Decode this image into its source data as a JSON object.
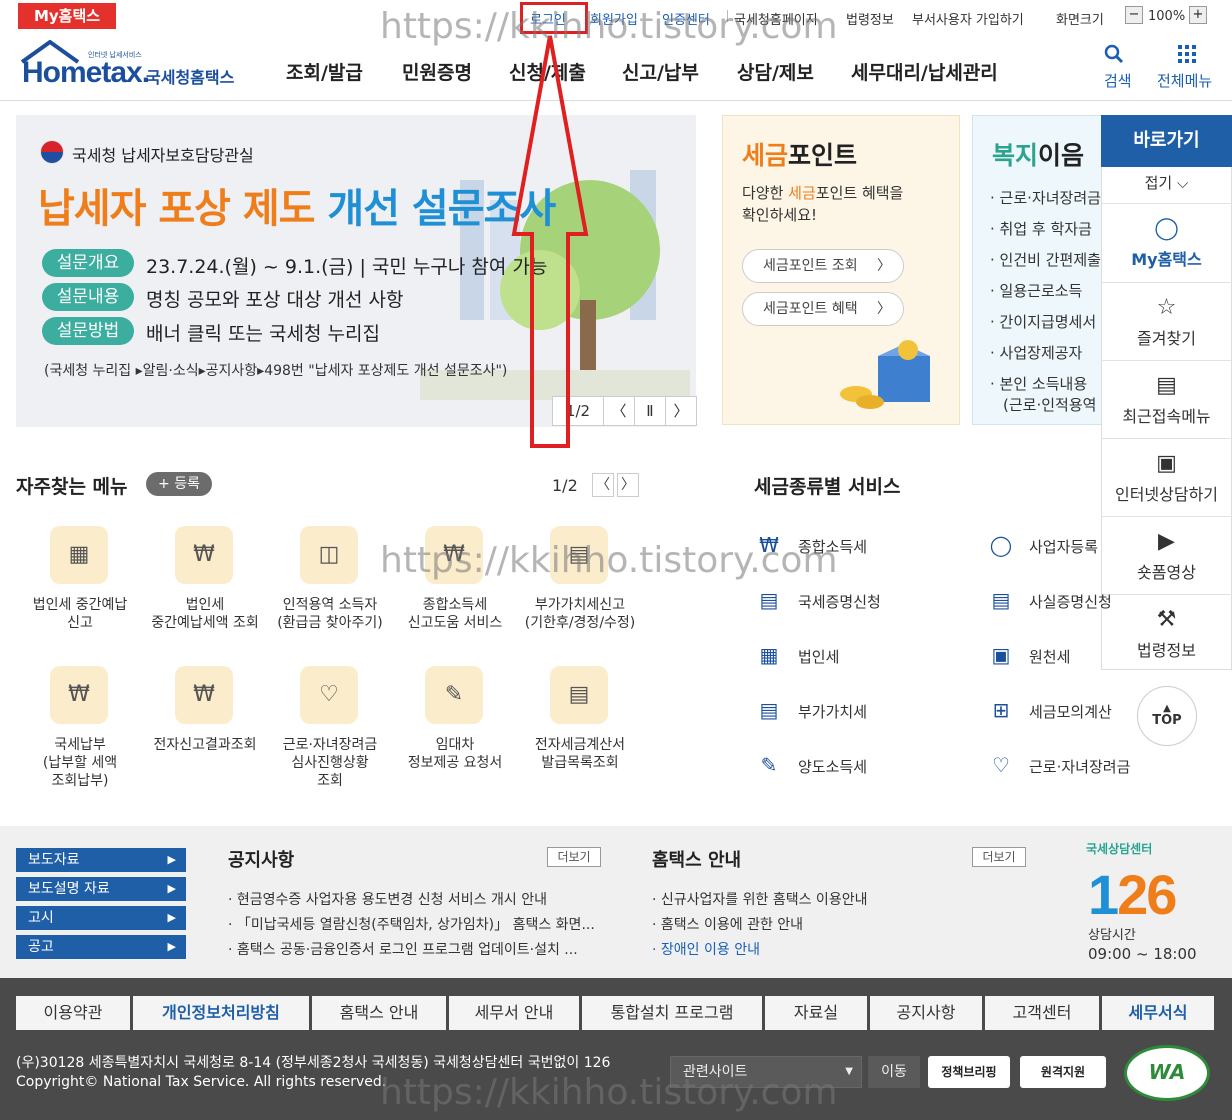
{
  "top_bar": {
    "my_hometax": "My홈택스",
    "links": [
      "로그인",
      "회원가입",
      "인증센터",
      "국세청홈페이지",
      "법령정보",
      "부서사용자 가입하기",
      "화면크기"
    ],
    "zoom_minus": "−",
    "zoom_value": "100%",
    "zoom_plus": "+"
  },
  "logo": {
    "tiny": "인터넷 납세서비스",
    "word": "Hometax.",
    "sub": "국세청홈택스"
  },
  "nav": {
    "items": [
      "조회/발급",
      "민원증명",
      "신청/제출",
      "신고/납부",
      "상담/제보",
      "세무대리/납세관리"
    ],
    "search": "검색",
    "all_menu": "전체메뉴"
  },
  "banner": {
    "org": "국세청 납세자보호담당관실",
    "title_a": "납세자 포상 제도 ",
    "title_b": "개선 설문조사",
    "rows": [
      {
        "pill": "설문개요",
        "text": "23.7.24.(월) ~ 9.1.(금) | 국민 누구나 참여 가능"
      },
      {
        "pill": "설문내용",
        "text": "명칭 공모와 포상 대상 개선 사항"
      },
      {
        "pill": "설문방법",
        "text": "배너 클릭 또는 국세청 누리집"
      }
    ],
    "note": "(국세청 누리집 ▸알림·소식▸공지사항▸498번 \"납세자 포상제도 개선 설문조사\")",
    "page": "1/2",
    "prev": "〈",
    "pause": "Ⅱ",
    "next": "〉"
  },
  "point": {
    "title_a": "세금",
    "title_b": "포인트",
    "desc_a": "다양한 ",
    "desc_b": "세금",
    "desc_c": "포인트 혜택을",
    "desc_d": "확인하세요!",
    "btn1": "세금포인트 조회",
    "btn2": "세금포인트 혜택",
    "chev": "〉"
  },
  "welfare": {
    "title_a": "복지",
    "title_b": "이음",
    "items": [
      "근로·자녀장려금",
      "취업 후 학자금",
      "인건비 간편제출",
      "일용근로소득",
      "간이지급명세서",
      "사업장제공자",
      "본인 소득내용",
      "(근로·인적용역"
    ]
  },
  "quick": {
    "title": "바로가기",
    "fold": "접기 ⌵",
    "items": [
      {
        "icon": "person-icon",
        "label": "My홈택스"
      },
      {
        "icon": "star-icon",
        "label": "즐겨찾기"
      },
      {
        "icon": "recent-icon",
        "label": "최근접속메뉴"
      },
      {
        "icon": "laptop-icon",
        "label": "인터넷상담하기"
      },
      {
        "icon": "play-icon",
        "label": "숏폼영상"
      },
      {
        "icon": "gavel-icon",
        "label": "법령정보"
      }
    ],
    "top": "TOP"
  },
  "favorites": {
    "title": "자주찾는 메뉴",
    "register": "+ 등록",
    "page": "1/2",
    "prev": "〈",
    "next": "〉",
    "items": [
      [
        "법인세 중간예납",
        "신고"
      ],
      [
        "법인세",
        "중간예납세액 조회"
      ],
      [
        "인적용역 소득자",
        "(환급금 찾아주기)"
      ],
      [
        "종합소득세",
        "신고도움 서비스"
      ],
      [
        "부가가치세신고",
        "(기한후/경정/수정)"
      ],
      [
        "국세납부",
        "(납부할 세액",
        "조회납부)"
      ],
      [
        "전자신고결과조회"
      ],
      [
        "근로·자녀장려금",
        "심사진행상황",
        "조회"
      ],
      [
        "임대차",
        "정보제공 요청서"
      ],
      [
        "전자세금계산서",
        "발급목록조회"
      ]
    ]
  },
  "tax_types": {
    "title": "세금종류별 서비스",
    "items": [
      "종합소득세",
      "사업자등록",
      "국세증명신청",
      "사실증명신청",
      "법인세",
      "원천세",
      "부가가치세",
      "세금모의계산",
      "양도소득세",
      "근로·자녀장려금"
    ]
  },
  "notices": {
    "tabs": [
      "보도자료",
      "보도설명 자료",
      "고시",
      "공고"
    ],
    "notice_title": "공지사항",
    "more": "더보기",
    "notice_items": [
      "현금영수증 사업자용 용도변경 신청 서비스 개시 안내",
      "「미납국세등 열람신청(주택임차, 상가임차)」 홈택스 화면...",
      "홈택스 공동·금융인증서 로그인 프로그램 업데이트·설치 ..."
    ],
    "guide_title": "홈택스 안내",
    "guide_items": [
      "신규사업자를 위한 홈택스 이용안내",
      "홈택스 이용에 관한 안내",
      "장애인 이용 안내"
    ]
  },
  "callcenter": {
    "label": "국세상담센터",
    "num_a": "1",
    "num_b": "26",
    "hours_label": "상담시간",
    "hours": "09:00 ~ 18:00"
  },
  "footer": {
    "nav": [
      "이용약관",
      "개인정보처리방침",
      "홈택스 안내",
      "세무서 안내",
      "통합설치 프로그램",
      "자료실",
      "공지사항",
      "고객센터",
      "세무서식"
    ],
    "address": "(우)30128 세종특별자치시 국세청로 8-14 (정부세종2청사 국세청동) 국세청상담센터 국번없이 126",
    "copyright": "Copyright© National Tax Service. All rights reserved.",
    "related": "관련사이트",
    "go": "이동",
    "badge1": "정책브리핑",
    "badge2": "원격지원",
    "wa": "WA"
  },
  "watermark": "https://kkihho.tistory.com",
  "colors": {
    "brand_blue": "#1f5fa8",
    "accent_orange": "#ef7d1a",
    "red": "#e4312b",
    "teal": "#3cae9f",
    "annotation_red": "#e02020"
  }
}
